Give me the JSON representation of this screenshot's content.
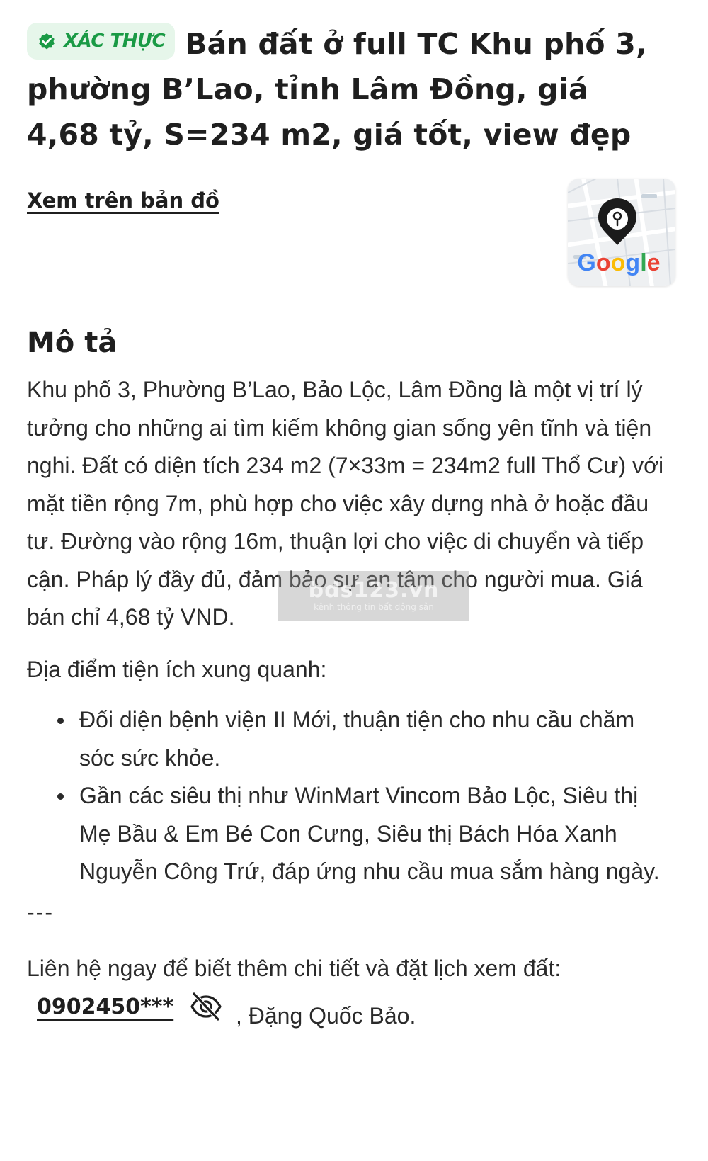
{
  "listing": {
    "verified_label": "XÁC THỰC",
    "title": "Bán đất ở full TC Khu phố 3, phường B’Lao, tỉnh Lâm Đồng, giá 4,68 tỷ, S=234 m2, giá tốt, view đẹp"
  },
  "map": {
    "link_label": "Xem trên bản đồ",
    "thumb_brand": "Google",
    "thumb_icon": "map-pin-icon"
  },
  "description": {
    "heading": "Mô tả",
    "paragraph": "Khu phố 3, Phường B’Lao, Bảo Lộc, Lâm Đồng là một vị trí lý tưởng cho những ai tìm kiếm không gian sống yên tĩnh và tiện nghi. Đất có diện tích 234 m2 (7×33m = 234m2 full Thổ Cư) với mặt tiền rộng 7m, phù hợp cho việc xây dựng nhà ở hoặc đầu tư. Đường vào rộng 16m, thuận lợi cho việc di chuyển và tiếp cận. Pháp lý đầy đủ, đảm bảo sự an tâm cho người mua. Giá bán chỉ 4,68 tỷ VND.",
    "amenities_heading": "Địa điểm tiện ích xung quanh:",
    "amenities": [
      "Đối diện bệnh viện II Mới, thuận tiện cho nhu cầu chăm sóc sức khỏe.",
      "Gần các siêu thị như WinMart Vincom Bảo Lộc, Siêu thị Mẹ Bầu & Em Bé Con Cưng, Siêu thị Bách Hóa Xanh Nguyễn Công Trứ, đáp ứng nhu cầu mua sắm hàng ngày."
    ],
    "separator": "---",
    "contact_prefix": "Liên hệ ngay để biết thêm chi tiết và đặt lịch xem đất:",
    "phone_masked": "0902450***",
    "contact_suffix": ", Đặng Quốc Bảo."
  },
  "watermark": {
    "main": "bds123.vn",
    "sub": "kênh thông tin bất động sản"
  },
  "colors": {
    "badge_bg": "#e6f6ea",
    "badge_fg": "#1a9a45",
    "text": "#2a2a2a"
  }
}
